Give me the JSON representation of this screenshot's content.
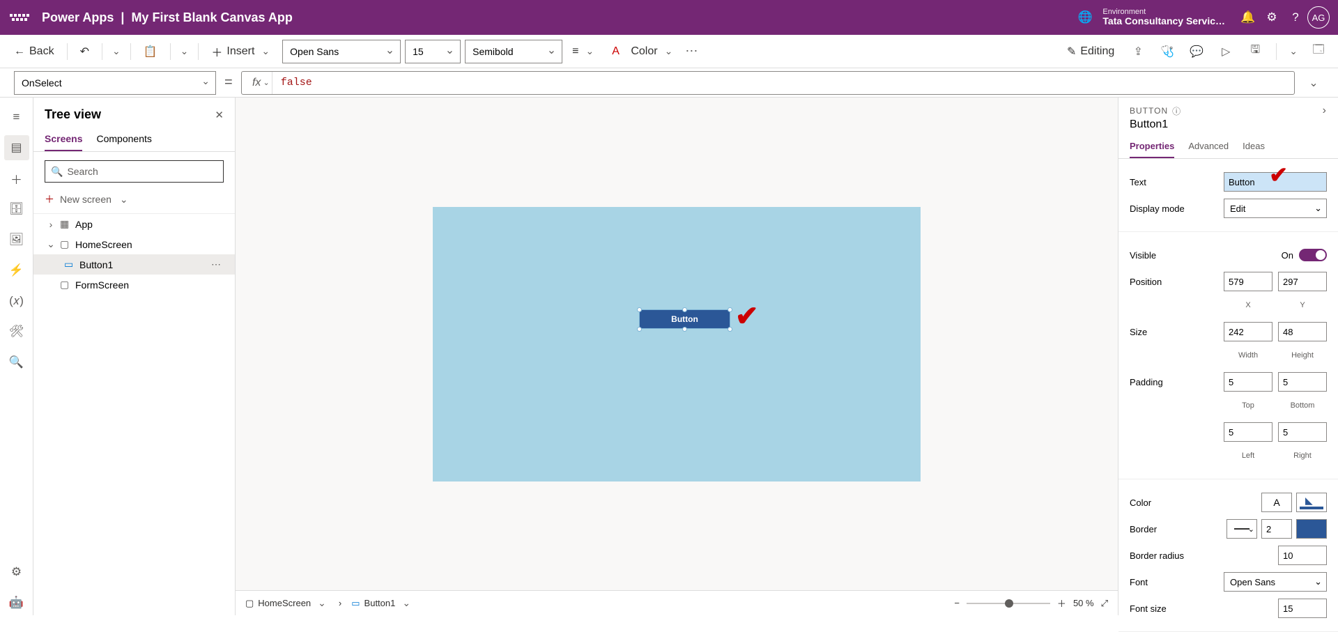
{
  "header": {
    "brand": "Power Apps",
    "sep": "|",
    "appname": "My First Blank Canvas App",
    "env_label": "Environment",
    "env_value": "Tata Consultancy Servic…",
    "avatar": "AG"
  },
  "toolbar": {
    "back": "Back",
    "insert": "Insert",
    "font": "Open Sans",
    "fontsize": "15",
    "fontweight": "Semibold",
    "color": "Color",
    "editing": "Editing"
  },
  "formula": {
    "property": "OnSelect",
    "fx": "fx",
    "value": "false"
  },
  "tree": {
    "title": "Tree view",
    "tabs": {
      "screens": "Screens",
      "components": "Components"
    },
    "search": "Search",
    "newscreen": "New screen",
    "app": "App",
    "homescreen": "HomeScreen",
    "button1": "Button1",
    "formscreen": "FormScreen"
  },
  "canvas": {
    "button_text": "Button",
    "crumb_screen": "HomeScreen",
    "crumb_control": "Button1",
    "zoom_val": "50",
    "zoom_pct": "%"
  },
  "props": {
    "type": "BUTTON",
    "name": "Button1",
    "tabs": {
      "properties": "Properties",
      "advanced": "Advanced",
      "ideas": "Ideas"
    },
    "text_lbl": "Text",
    "text_val": "Button",
    "displaymode_lbl": "Display mode",
    "displaymode_val": "Edit",
    "visible_lbl": "Visible",
    "visible_on": "On",
    "position_lbl": "Position",
    "pos_x": "579",
    "pos_y": "297",
    "x": "X",
    "y": "Y",
    "size_lbl": "Size",
    "w": "242",
    "h": "48",
    "width": "Width",
    "height": "Height",
    "padding_lbl": "Padding",
    "pt": "5",
    "pb": "5",
    "pl": "5",
    "pr": "5",
    "top": "Top",
    "bottom": "Bottom",
    "left": "Left",
    "right": "Right",
    "color_lbl": "Color",
    "border_lbl": "Border",
    "border_val": "2",
    "borderradius_lbl": "Border radius",
    "borderradius_val": "10",
    "font_lbl": "Font",
    "font_val": "Open Sans",
    "fontsize_lbl": "Font size",
    "fontsize_val": "15"
  }
}
